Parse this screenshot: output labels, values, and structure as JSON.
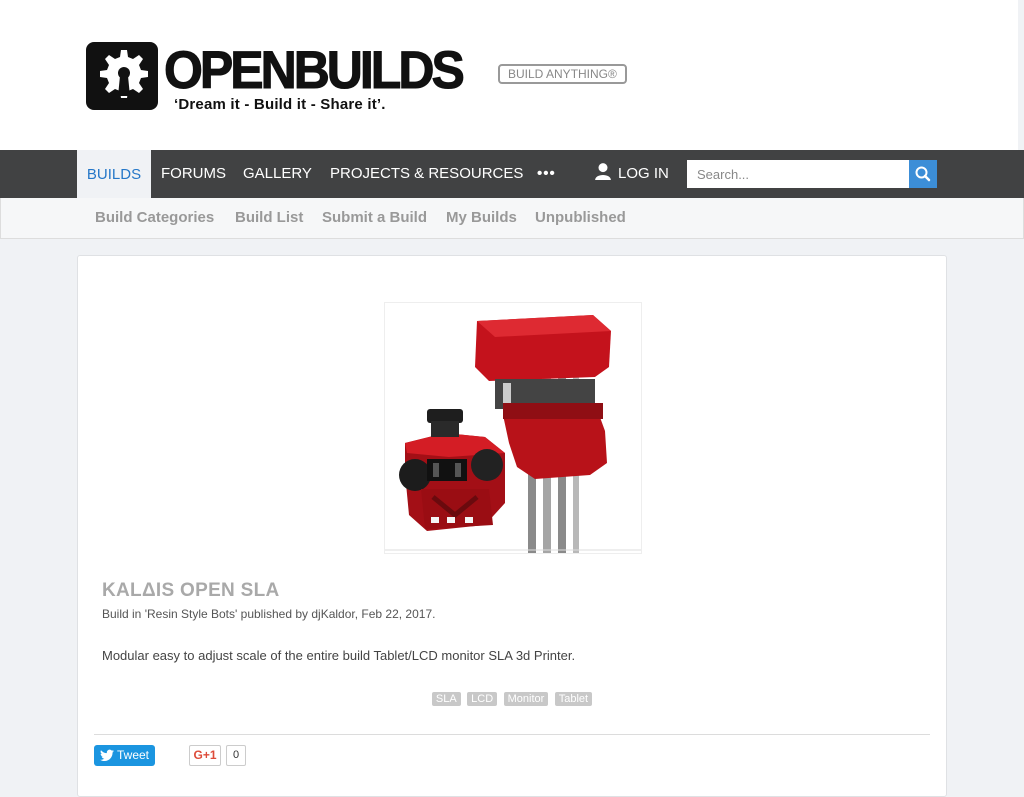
{
  "header": {
    "logo_word": "OPENBUILDS",
    "logo_tagline": "‘Dream it - Build it - Share it’.",
    "slogan_badge": "BUILD ANYTHING®"
  },
  "nav": {
    "items": [
      {
        "label": "BUILDS",
        "active": true
      },
      {
        "label": "FORUMS"
      },
      {
        "label": "GALLERY"
      },
      {
        "label": "PROJECTS & RESOURCES"
      },
      {
        "label": "•••"
      }
    ],
    "login_label": "LOG IN",
    "search_placeholder": "Search...",
    "icons": {
      "login": "user-icon",
      "search": "search-icon"
    }
  },
  "subnav": {
    "items": [
      "Build Categories",
      "Build List",
      "Submit a Build",
      "My Builds",
      "Unpublished"
    ]
  },
  "build": {
    "title": "KALΔIS OPEN SLA",
    "meta": "Build in 'Resin Style Bots' published by djKaldor, Feb 22, 2017.",
    "description": "Modular easy to adjust scale of the entire build Tablet/LCD monitor SLA 3d Printer.",
    "tags": [
      "SLA",
      "LCD",
      "Monitor",
      "Tablet"
    ],
    "image_subject": "red-3d-printer-render"
  },
  "share": {
    "tweet_label": "Tweet",
    "gplus_label": "G+1",
    "gplus_count": "0"
  },
  "colors": {
    "nav_bg": "#414243",
    "accent": "#2577c8",
    "search_button": "#3c8ed7",
    "tweet_button": "#1b95e0",
    "gplus": "#dd4b39",
    "printer_red": "#b5121b"
  }
}
